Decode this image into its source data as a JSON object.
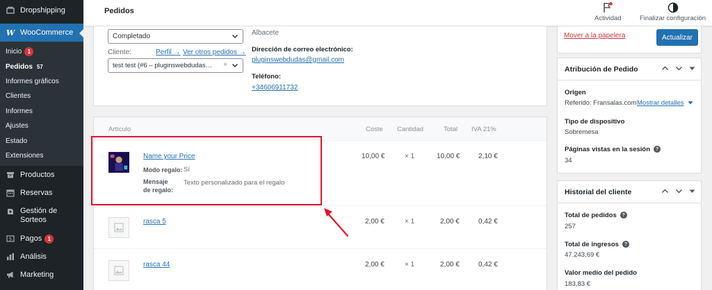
{
  "sidebar": {
    "top_item": "Dropshipping",
    "current_menu": "WooCommerce",
    "sub_items": [
      {
        "label": "Inicio",
        "badge": "1"
      },
      {
        "label": "Pedidos",
        "count": "57"
      },
      {
        "label": "Informes gráficos"
      },
      {
        "label": "Clientes"
      },
      {
        "label": "Informes"
      },
      {
        "label": "Ajustes"
      },
      {
        "label": "Estado"
      },
      {
        "label": "Extensiones"
      }
    ],
    "menu_items": [
      {
        "label": "Productos",
        "icon": "archive-icon"
      },
      {
        "label": "Reservas",
        "icon": "calendar-icon"
      },
      {
        "label": "Gestión de Sorteos",
        "icon": "ticket-icon"
      },
      {
        "label": "Pagos",
        "icon": "dollar-icon",
        "badge": "1"
      },
      {
        "label": "Análisis",
        "icon": "bar-chart-icon"
      },
      {
        "label": "Marketing",
        "icon": "megaphone-icon"
      }
    ]
  },
  "header": {
    "title": "Pedidos",
    "activity_label": "Actividad",
    "finish_setup_label": "Finalizar configuración"
  },
  "order": {
    "status_value": "Completado",
    "customer_label": "Cliente:",
    "profile_link": "Perfil →",
    "other_orders_link": "Ver otros pedidos →",
    "customer_value": "test test (#6 – pluginswebdudas…",
    "city": "Albacete",
    "email_label": "Dirección de correo electrónico:",
    "email_value": "pluginswebdudas@gmail.com",
    "phone_label": "Teléfono:",
    "phone_value": "+34606911732"
  },
  "items": {
    "headers": {
      "article": "Artículo",
      "cost": "Coste",
      "quantity": "Cantidad",
      "total": "Total",
      "tax": "IVA 21%"
    },
    "rows": [
      {
        "name": "Name your Price",
        "cost": "10,00 €",
        "qty": "× 1",
        "total": "10,00 €",
        "tax": "2,10 €",
        "meta": [
          {
            "label": "Modo regalo:",
            "value": "Sí"
          },
          {
            "label": "Mensaje de regalo:",
            "value": "Texto personalizado para el regalo"
          }
        ]
      },
      {
        "name": "rasca 5",
        "cost": "2,00 €",
        "qty": "× 1",
        "total": "2,00 €",
        "tax": "0,42 €"
      },
      {
        "name": "rasca 44",
        "cost": "2,00 €",
        "qty": "× 1",
        "total": "2,00 €",
        "tax": "0,42 €"
      }
    ]
  },
  "actions": {
    "trash_link": "Mover a la papelera",
    "update_button": "Actualizar"
  },
  "attribution": {
    "title": "Atribución de Pedido",
    "origin_label": "Origen",
    "origin_value": "Referido: Fransalas.com",
    "show_details": "Mostrar detalles",
    "device_label": "Tipo de dispositivo",
    "device_value": "Sobremesa",
    "pages_label": "Páginas vistas en la sesión",
    "pages_value": "34"
  },
  "history": {
    "title": "Historial del cliente",
    "total_orders_label": "Total de pedidos",
    "total_orders_value": "257",
    "total_revenue_label": "Total de ingresos",
    "total_revenue_value": "47.243,69 €",
    "avg_order_label": "Valor medio del pedido",
    "avg_order_value": "183,83 €"
  },
  "colors": {
    "accent": "#2271b1",
    "sidebar": "#1d2327",
    "highlight": "#e6122a",
    "badge": "#d63638"
  }
}
